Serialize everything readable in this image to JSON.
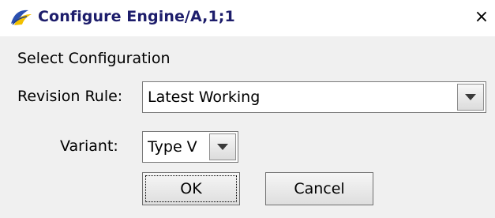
{
  "window": {
    "title": "Configure Engine/A,1;1",
    "close_glyph": "×"
  },
  "form": {
    "section_label": "Select Configuration",
    "revision_rule": {
      "label": "Revision Rule:",
      "value": "Latest Working"
    },
    "variant": {
      "label": "Variant:",
      "value": "Type V"
    }
  },
  "buttons": {
    "ok_label": "OK",
    "cancel_label": "Cancel"
  },
  "icons": {
    "app": "teamcenter-app-icon",
    "dropdown": "chevron-down-icon"
  },
  "colors": {
    "title_text": "#1d1d6b",
    "dialog_bg": "#f0f0f0"
  }
}
